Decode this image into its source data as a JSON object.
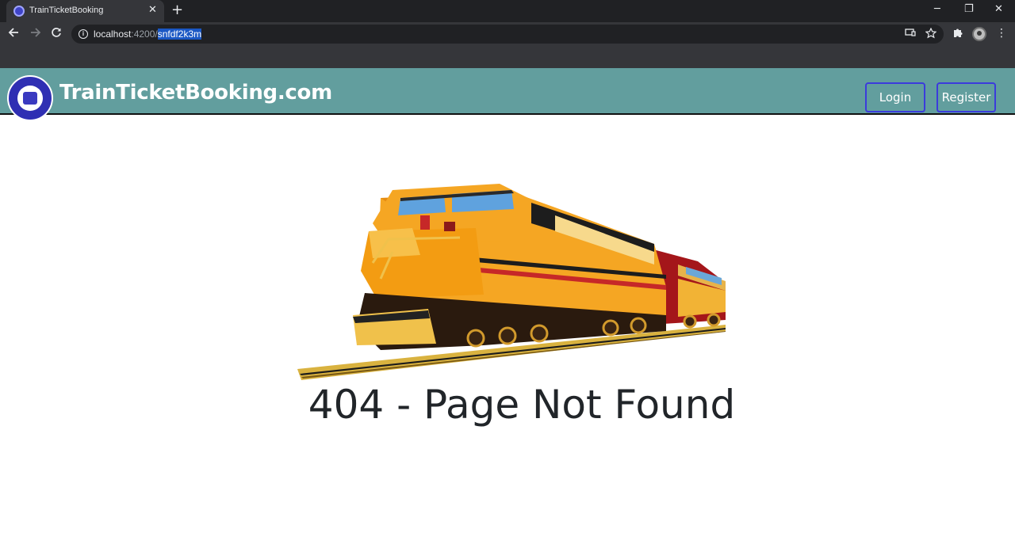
{
  "browser": {
    "tab_title": "TrainTicketBooking",
    "tab_close": "✕",
    "new_tab": "+",
    "url": {
      "host": "localhost",
      "port": ":4200/",
      "path": "snfdf2k3m"
    },
    "window_controls": {
      "minimize": "─",
      "restore": "❐",
      "close": "✕"
    },
    "icons": {
      "back": "arrow-left-icon",
      "forward": "arrow-right-icon",
      "reload": "reload-icon",
      "site_info": "info-icon",
      "cast": "cast-icon",
      "bookmark": "star-icon",
      "extensions": "puzzle-icon",
      "profile": "avatar",
      "menu": "kebab-menu-icon"
    }
  },
  "navbar": {
    "brand": "TrainTicketBooking.com",
    "login_label": "Login",
    "register_label": "Register",
    "background": "#629e9e",
    "button_border": "#3b3bdc"
  },
  "main": {
    "heading": "404 - Page Not Found",
    "image": "train-illustration"
  }
}
